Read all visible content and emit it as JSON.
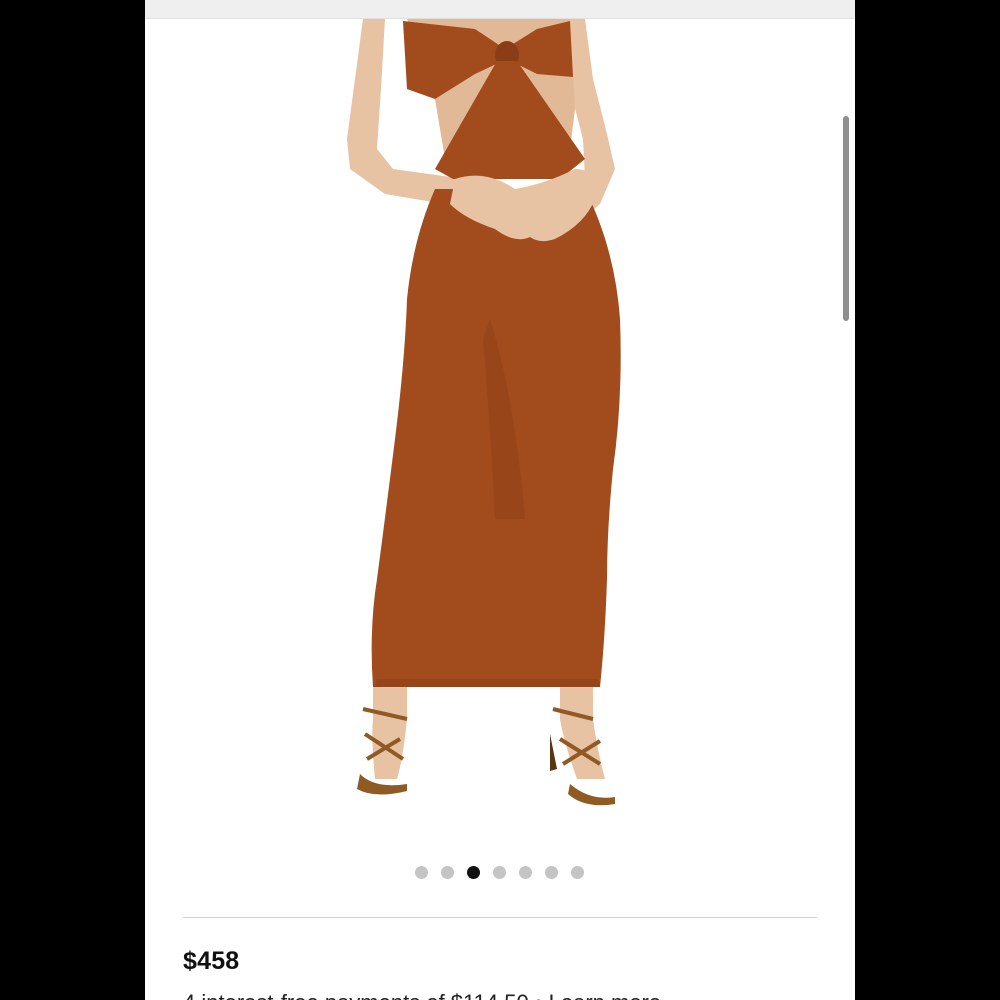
{
  "gallery": {
    "dot_count": 7,
    "active_index": 2
  },
  "product": {
    "price": "$458",
    "installment_text": "4 interest-free payments of $114.50 • Learn more"
  },
  "colors": {
    "dress": "#a24b1d",
    "dress_dark": "#8a3d16",
    "skin": "#e7c3a4",
    "sandal": "#8f5a24"
  }
}
